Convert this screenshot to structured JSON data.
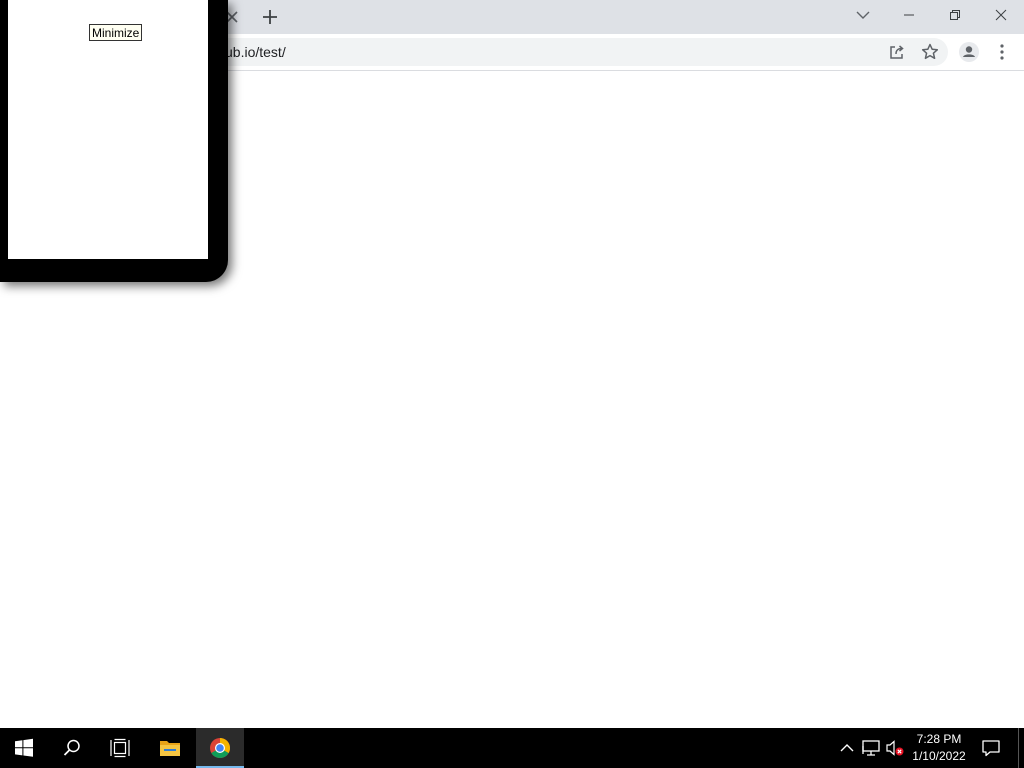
{
  "browser": {
    "address_url": "ub.io/test/"
  },
  "popup": {
    "minimize_label": "Minimize"
  },
  "taskbar": {
    "time": "7:28 PM",
    "date": "1/10/2022",
    "apps": [
      {
        "icon": "file-explorer-icon"
      },
      {
        "icon": "chrome-icon",
        "active": true
      }
    ]
  }
}
